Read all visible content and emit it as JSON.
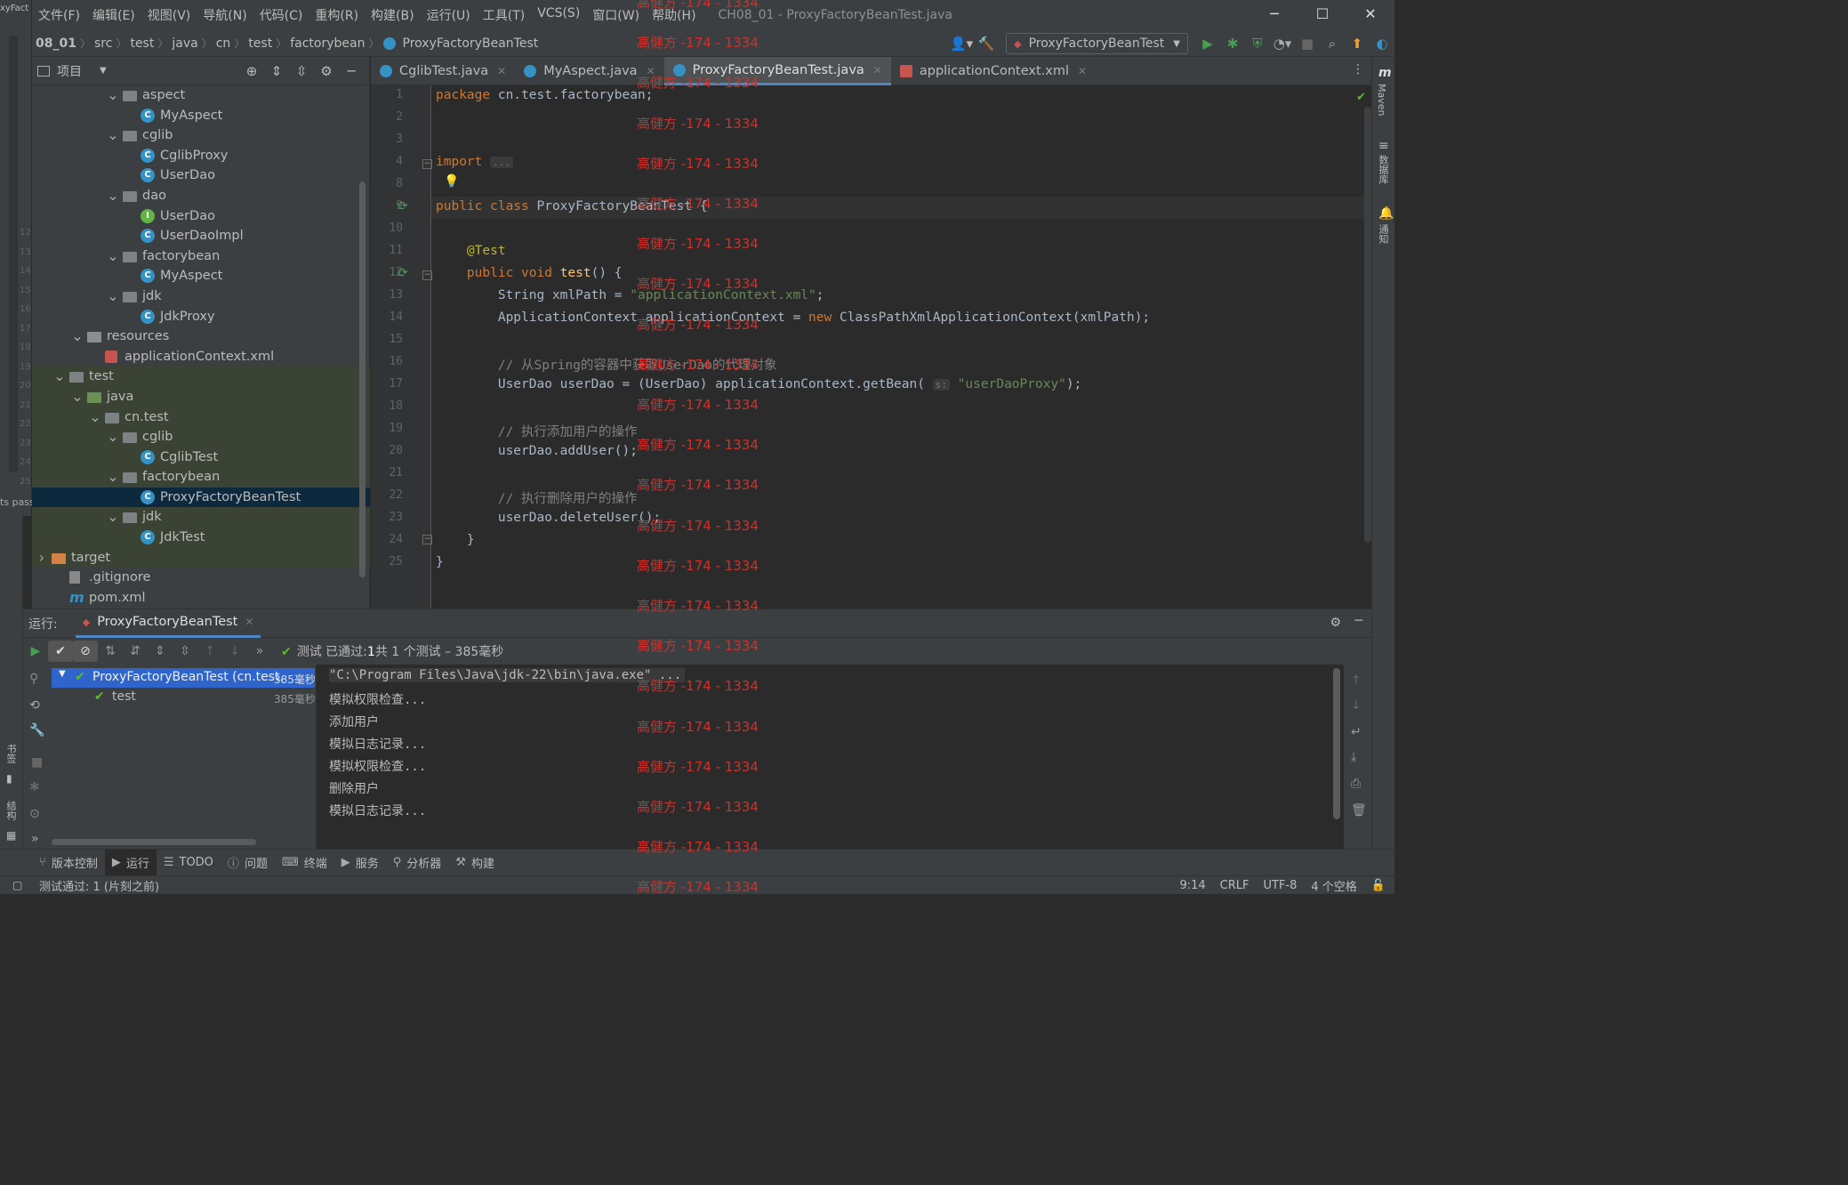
{
  "background_window": {
    "title": "xyFact",
    "line_numbers": [
      "12",
      "13",
      "14",
      "15",
      "16",
      "17",
      "18",
      "19",
      "20",
      "21",
      "22",
      "23",
      "24",
      "25"
    ],
    "status": "ts passe"
  },
  "menu": {
    "items": [
      "文件(F)",
      "编辑(E)",
      "视图(V)",
      "导航(N)",
      "代码(C)",
      "重构(R)",
      "构建(B)",
      "运行(U)",
      "工具(T)",
      "VCS(S)",
      "窗口(W)",
      "帮助(H)"
    ],
    "window_title": "CH08_01 - ProxyFactoryBeanTest.java"
  },
  "breadcrumb": [
    "08_01",
    "src",
    "test",
    "java",
    "cn",
    "test",
    "factorybean",
    "ProxyFactoryBeanTest"
  ],
  "run_config": {
    "label": "ProxyFactoryBeanTest"
  },
  "project_panel": {
    "title": "项目",
    "tree": [
      {
        "label": "aspect",
        "kind": "folder",
        "depth": 4,
        "expanded": true
      },
      {
        "label": "MyAspect",
        "kind": "class",
        "depth": 5
      },
      {
        "label": "cglib",
        "kind": "folder",
        "depth": 4,
        "expanded": true
      },
      {
        "label": "CglibProxy",
        "kind": "class",
        "depth": 5
      },
      {
        "label": "UserDao",
        "kind": "class",
        "depth": 5
      },
      {
        "label": "dao",
        "kind": "folder",
        "depth": 4,
        "expanded": true
      },
      {
        "label": "UserDao",
        "kind": "interface",
        "depth": 5
      },
      {
        "label": "UserDaoImpl",
        "kind": "class",
        "depth": 5
      },
      {
        "label": "factorybean",
        "kind": "folder",
        "depth": 4,
        "expanded": true
      },
      {
        "label": "MyAspect",
        "kind": "class",
        "depth": 5
      },
      {
        "label": "jdk",
        "kind": "folder",
        "depth": 4,
        "expanded": true
      },
      {
        "label": "JdkProxy",
        "kind": "class",
        "depth": 5
      },
      {
        "label": "resources",
        "kind": "res",
        "depth": 2,
        "expanded": true
      },
      {
        "label": "applicationContext.xml",
        "kind": "xml",
        "depth": 3
      },
      {
        "label": "test",
        "kind": "folder",
        "depth": 1,
        "expanded": true,
        "test": true
      },
      {
        "label": "java",
        "kind": "src",
        "depth": 2,
        "expanded": true,
        "test": true
      },
      {
        "label": "cn.test",
        "kind": "folder",
        "depth": 3,
        "expanded": true,
        "test": true
      },
      {
        "label": "cglib",
        "kind": "folder",
        "depth": 4,
        "expanded": true,
        "test": true
      },
      {
        "label": "CglibTest",
        "kind": "class",
        "depth": 5,
        "test": true
      },
      {
        "label": "factorybean",
        "kind": "folder",
        "depth": 4,
        "expanded": true,
        "test": true
      },
      {
        "label": "ProxyFactoryBeanTest",
        "kind": "class",
        "depth": 5,
        "test": true,
        "selected": true
      },
      {
        "label": "jdk",
        "kind": "folder",
        "depth": 4,
        "expanded": true,
        "test": true
      },
      {
        "label": "JdkTest",
        "kind": "class",
        "depth": 5,
        "test": true
      },
      {
        "label": "target",
        "kind": "target",
        "depth": 0,
        "expanded": false,
        "test": true
      },
      {
        "label": ".gitignore",
        "kind": "file",
        "depth": 1
      },
      {
        "label": "pom.xml",
        "kind": "maven",
        "depth": 1
      }
    ]
  },
  "editor_tabs": [
    {
      "label": "CglibTest.java",
      "type": "class",
      "active": false
    },
    {
      "label": "MyAspect.java",
      "type": "class",
      "active": false
    },
    {
      "label": "ProxyFactoryBeanTest.java",
      "type": "class",
      "active": true
    },
    {
      "label": "applicationContext.xml",
      "type": "xml",
      "active": false
    }
  ],
  "code_lines": [
    {
      "n": "1",
      "html": "<span class='kw'>package</span> cn.test.factorybean;"
    },
    {
      "n": "2",
      "html": ""
    },
    {
      "n": "3",
      "html": ""
    },
    {
      "n": "4",
      "html": "<span class='kw'>import</span> <span class='hint'>...</span>"
    },
    {
      "n": "8",
      "html": ""
    },
    {
      "n": "9",
      "html": "<span class='kw'>public class</span> ProxyFactoryBeanTest {"
    },
    {
      "n": "10",
      "html": ""
    },
    {
      "n": "11",
      "html": "    <span class='ann'>@Test</span>"
    },
    {
      "n": "12",
      "html": "    <span class='kw'>public void</span> <span class='fn'>test</span>() {"
    },
    {
      "n": "13",
      "html": "        String xmlPath = <span class='str'>\"applicationContext.xml\"</span>;"
    },
    {
      "n": "14",
      "html": "        ApplicationContext applicationContext = <span class='kw'>new</span> ClassPathXmlApplicationContext(xmlPath);"
    },
    {
      "n": "15",
      "html": ""
    },
    {
      "n": "16",
      "html": "        <span class='cmt'>// 从Spring的容器中获取UserDao的代理对象</span>"
    },
    {
      "n": "17",
      "html": "        UserDao userDao = (UserDao) applicationContext.getBean( <span class='hint'>s:</span> <span class='str'>\"userDaoProxy\"</span>);"
    },
    {
      "n": "18",
      "html": ""
    },
    {
      "n": "19",
      "html": "        <span class='cmt'>// 执行添加用户的操作</span>"
    },
    {
      "n": "20",
      "html": "        userDao.addUser();"
    },
    {
      "n": "21",
      "html": ""
    },
    {
      "n": "22",
      "html": "        <span class='cmt'>// 执行删除用户的操作</span>"
    },
    {
      "n": "23",
      "html": "        userDao.deleteUser();"
    },
    {
      "n": "24",
      "html": "    }"
    },
    {
      "n": "25",
      "html": "}"
    }
  ],
  "right_strip": {
    "maven": "Maven",
    "database": "数据库",
    "notifications": "通知"
  },
  "left_strip": {
    "bookmarks": "书签",
    "structure": "结构"
  },
  "run_panel": {
    "label": "运行:",
    "tab": "ProxyFactoryBeanTest",
    "status_prefix": "测试 已通过:",
    "status_count": "1",
    "status_rest": "共 1 个测试 – 385毫秒",
    "tree": [
      {
        "label": "ProxyFactoryBeanTest (cn.test.",
        "time": "385毫秒"
      },
      {
        "label": "test",
        "time": "385毫秒"
      }
    ],
    "console": [
      "\"C:\\Program Files\\Java\\jdk-22\\bin\\java.exe\" ...",
      "模拟权限检查...",
      "添加用户",
      "模拟日志记录...",
      "模拟权限检查...",
      "删除用户",
      "模拟日志记录..."
    ]
  },
  "tool_windows": [
    "版本控制",
    "运行",
    "TODO",
    "问题",
    "终端",
    "服务",
    "分析器",
    "构建"
  ],
  "status_bar": {
    "message": "测试通过: 1 (片刻之前)",
    "position": "9:14",
    "line_sep": "CRLF",
    "encoding": "UTF-8",
    "indent": "4 个空格"
  },
  "watermark": "高健方 -174 - 1334",
  "colors": {
    "accent": "#4a88c7",
    "pass": "#5fb832",
    "selection": "#0d293e",
    "watermark": "#d0302a"
  }
}
